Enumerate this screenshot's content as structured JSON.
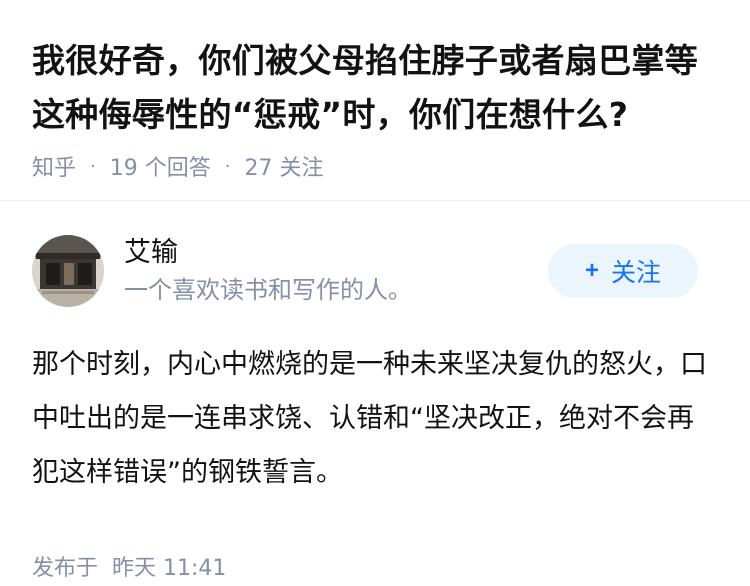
{
  "question": {
    "title": "我很好奇，你们被父母掐住脖子或者扇巴掌等这种侮辱性的“惩戒”时，你们在想什么?",
    "source": "知乎",
    "answers_count": "19 个回答",
    "follow_count": "27 关注"
  },
  "answer": {
    "author_name": "艾输",
    "author_bio": "一个喜欢读书和写作的人。",
    "follow_label": "关注",
    "follow_prefix": "+",
    "content": "那个时刻，内心中燃烧的是一种未来坚决复仇的怒火，口中吐出的是一连串求饶、认错和“坚决改正，绝对不会再犯这样错误”的钢铁誓言。",
    "published_prefix": "发布于",
    "published_time": "昨天 11:41"
  },
  "colors": {
    "meta_gray": "#8590a6",
    "accent_blue": "#1772f6",
    "button_bg": "#ebf5fd"
  }
}
